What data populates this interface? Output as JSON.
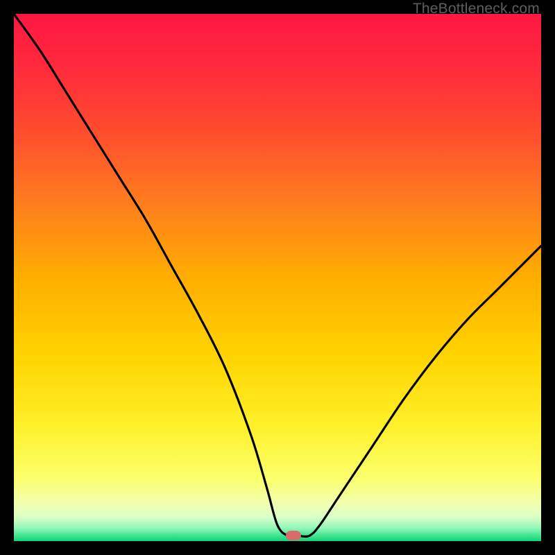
{
  "watermark": "TheBottleneck.com",
  "colors": {
    "gradient_stops": [
      {
        "offset": 0.0,
        "color": "#ff1744"
      },
      {
        "offset": 0.1,
        "color": "#ff2a3c"
      },
      {
        "offset": 0.22,
        "color": "#ff4b2e"
      },
      {
        "offset": 0.35,
        "color": "#ff7a1f"
      },
      {
        "offset": 0.5,
        "color": "#ffae00"
      },
      {
        "offset": 0.65,
        "color": "#ffd400"
      },
      {
        "offset": 0.78,
        "color": "#fff02a"
      },
      {
        "offset": 0.88,
        "color": "#fbff6b"
      },
      {
        "offset": 0.93,
        "color": "#f1ffb0"
      },
      {
        "offset": 0.955,
        "color": "#d9ffc8"
      },
      {
        "offset": 0.975,
        "color": "#94f7b9"
      },
      {
        "offset": 0.99,
        "color": "#3de48e"
      },
      {
        "offset": 1.0,
        "color": "#10d27a"
      }
    ],
    "curve": "#000000",
    "frame": "#000000",
    "marker": "#d86b6b"
  },
  "chart_data": {
    "type": "line",
    "title": "",
    "xlabel": "",
    "ylabel": "",
    "xlim": [
      0,
      100
    ],
    "ylim": [
      0,
      100
    ],
    "series": [
      {
        "name": "bottleneck-curve",
        "x": [
          0,
          5,
          10,
          15,
          20,
          25,
          30,
          35,
          40,
          45,
          48,
          50,
          52,
          54,
          56,
          58,
          62,
          68,
          74,
          80,
          86,
          92,
          100
        ],
        "values": [
          100,
          93,
          85,
          77,
          69,
          61,
          52,
          43,
          33,
          20,
          10,
          3,
          1,
          1,
          1,
          3,
          9,
          18,
          27,
          35,
          42,
          48,
          56
        ]
      }
    ],
    "marker": {
      "x": 53,
      "y": 1
    },
    "axes_visible": false,
    "grid": false
  }
}
